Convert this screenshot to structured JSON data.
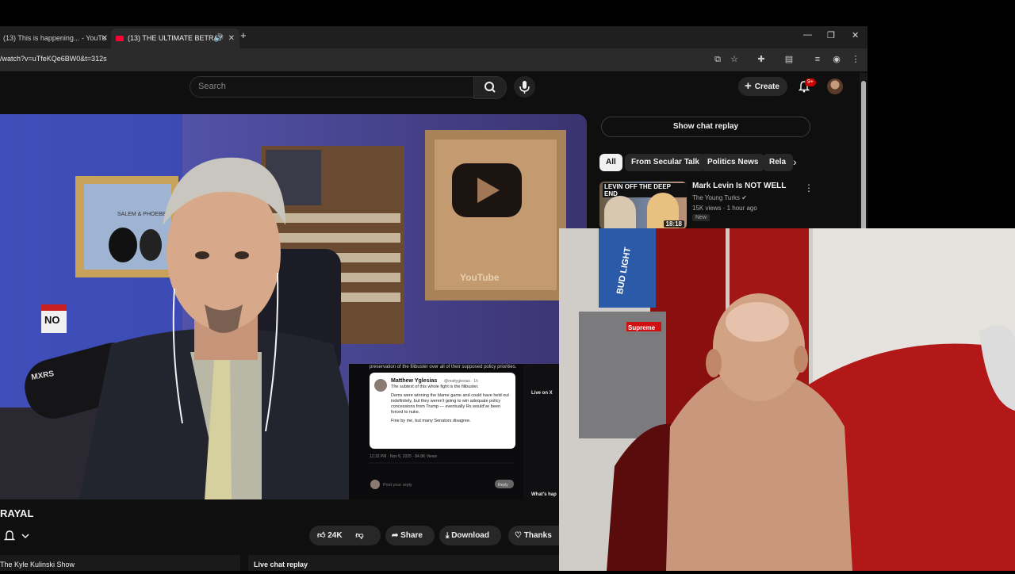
{
  "browser": {
    "tabs": [
      {
        "label": "(13) This is happening... - YouTu"
      },
      {
        "label": "(13) THE ULTIMATE BETRAY"
      }
    ],
    "url": "/watch?v=uTfeKQe6BW0&t=312s"
  },
  "header": {
    "search_placeholder": "Search",
    "create_label": "Create",
    "notification_count": "9+"
  },
  "video": {
    "title_fragment": "RAYAL",
    "tweet": {
      "context": "preservation of the filibuster over all of their supposed policy priorities.",
      "author": "Matthew Yglesias",
      "handle": "@mattyglesias · 1h",
      "body1": "The subtext of this whole fight is the filibuster.",
      "body2": "Dems were winning the blame game and could have held out indefinitely, but they weren't going to win adequate policy concessions from Trump — eventually Rs would've been forced to nuke.",
      "body3": "Fine by me, but many Senators disagree.",
      "timestamp": "12:32 PM · Nov 8, 2025 · 84.8K Views",
      "reply_placeholder": "Post your reply",
      "reply_btn": "Reply",
      "live_label": "Live on X",
      "whats_happening": "What's hap"
    },
    "badge_text": "NO",
    "mic_brand": "MXRS",
    "plaque_text": "YouTube",
    "sign_text": "SALEM & PHOEBE"
  },
  "actions": {
    "likes": "24K",
    "share": "Share",
    "download": "Download",
    "thanks": "Thanks"
  },
  "below_video": {
    "channel": "The Kyle Kulinski Show",
    "chat_tab": "Live chat replay"
  },
  "sidebar": {
    "show_chat_label": "Show chat replay",
    "chips": [
      "All",
      "From Secular Talk",
      "Politics News",
      "Rela"
    ],
    "recommendation": {
      "title": "Mark Levin Is NOT WELL",
      "channel": "The Young Turks",
      "meta": "15K views · 1 hour ago",
      "badge": "New",
      "duration": "18:18",
      "thumb_text": "LEVIN OFF THE DEEP END"
    }
  },
  "webcam": {
    "box_text": "BUD LIGHT",
    "sticker_text": "Supreme"
  }
}
